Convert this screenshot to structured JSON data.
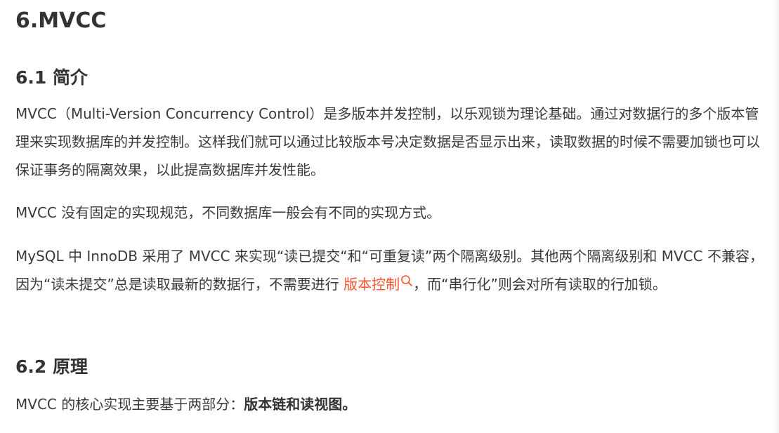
{
  "title": "6.MVCC",
  "sections": {
    "intro": {
      "heading": "6.1 简介",
      "p1": "MVCC（Multi-Version Concurrency Control）是多版本并发控制，以乐观锁为理论基础。通过对数据行的多个版本管理来实现数据库的并发控制。这样我们就可以通过比较版本号决定数据是否显示出来，读取数据的时候不需要加锁也可以保证事务的隔离效果，以此提高数据库并发性能。",
      "p2": "MVCC 没有固定的实现规范，不同数据库一般会有不同的实现方式。",
      "p3_before": "MySQL 中 InnoDB 采用了 MVCC 来实现“读已提交“和“可重复读”两个隔离级别。其他两个隔离级别和 MVCC 不兼容，因为“读未提交”总是读取最新的数据行，不需要进行 ",
      "p3_link": "版本控制",
      "p3_after": "，而“串行化”则会对所有读取的行加锁。"
    },
    "principle": {
      "heading": "6.2 原理",
      "p_before": "MVCC 的核心实现主要基于两部分：",
      "p_bold": "版本链和读视图。"
    }
  },
  "colors": {
    "text": "#333333",
    "link": "#fc5531"
  },
  "icons": {
    "link_icon": "search-icon"
  }
}
